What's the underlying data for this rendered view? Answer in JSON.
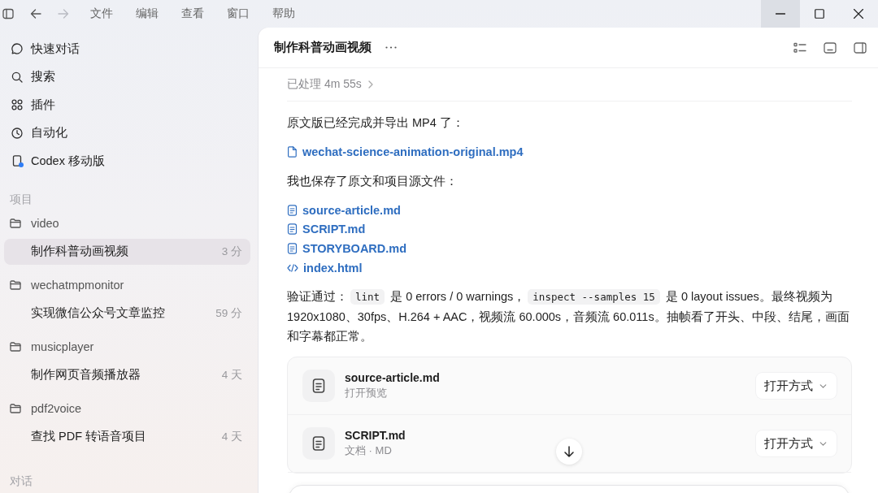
{
  "titlebar": {
    "history": [
      {
        "kind": "back",
        "disabled": false
      },
      {
        "kind": "forward",
        "disabled": true
      }
    ],
    "menus": [
      "文件",
      "编辑",
      "查看",
      "窗口",
      "帮助"
    ],
    "window_controls": [
      {
        "kind": "minimize",
        "hovered": true
      },
      {
        "kind": "maximize",
        "hovered": false
      },
      {
        "kind": "close",
        "hovered": false
      }
    ]
  },
  "sidebar": {
    "nav": [
      {
        "kind": "chat",
        "label": "快速对话",
        "selected": false,
        "badge": false
      },
      {
        "kind": "search",
        "label": "搜索",
        "selected": false,
        "badge": false
      },
      {
        "kind": "plugins",
        "label": "插件",
        "selected": false,
        "badge": false
      },
      {
        "kind": "automation",
        "label": "自动化",
        "selected": false,
        "badge": false
      },
      {
        "kind": "mobile",
        "label": "Codex 移动版",
        "selected": false,
        "badge": true
      }
    ],
    "projects_heading": "项目",
    "projects": [
      {
        "name": "video",
        "threads": [
          {
            "title": "制作科普动画视频",
            "time": "3 分",
            "selected": true
          }
        ]
      },
      {
        "name": "wechatmpmonitor",
        "threads": [
          {
            "title": "实现微信公众号文章监控",
            "time": "59 分",
            "selected": false
          }
        ]
      },
      {
        "name": "musicplayer",
        "threads": [
          {
            "title": "制作网页音频播放器",
            "time": "4 天",
            "selected": false
          }
        ]
      },
      {
        "name": "pdf2voice",
        "threads": [
          {
            "title": "查找 PDF 转语音项目",
            "time": "4 天",
            "selected": false
          }
        ]
      }
    ],
    "chats_heading": "对话"
  },
  "thread": {
    "title": "制作科普动画视频",
    "processed": "已处理 4m 55s",
    "blocks": [
      {
        "kind": "paragraph",
        "parts": [
          {
            "text": "原文版已经完成并导出 MP4 了：",
            "code": false
          }
        ]
      },
      {
        "kind": "links",
        "items": [
          {
            "kind": "file",
            "label": "wechat-science-animation-original.mp4"
          }
        ]
      },
      {
        "kind": "paragraph",
        "parts": [
          {
            "text": "我也保存了原文和项目源文件：",
            "code": false
          }
        ]
      },
      {
        "kind": "links",
        "items": [
          {
            "kind": "document",
            "label": "source-article.md"
          },
          {
            "kind": "document",
            "label": "SCRIPT.md"
          },
          {
            "kind": "document",
            "label": "STORYBOARD.md"
          },
          {
            "kind": "code",
            "label": "index.html"
          }
        ]
      },
      {
        "kind": "paragraph",
        "parts": [
          {
            "text": "验证通过：",
            "code": false
          },
          {
            "text": "lint",
            "code": true
          },
          {
            "text": " 是 0 errors / 0 warnings，",
            "code": false
          },
          {
            "text": "inspect --samples 15",
            "code": true
          },
          {
            "text": " 是 0 layout issues。最终视频为 1920x1080、30fps、H.264 + AAC，视频流 60.000s，音频流 60.011s。抽帧看了开头、中段、结尾，画面和字幕都正常。",
            "code": false
          }
        ]
      },
      {
        "kind": "files",
        "items": [
          {
            "name": "source-article.md",
            "detail": "打开预览",
            "action": "打开方式"
          },
          {
            "name": "SCRIPT.md",
            "detail": "文档 · MD",
            "action": "打开方式"
          }
        ]
      }
    ]
  }
}
